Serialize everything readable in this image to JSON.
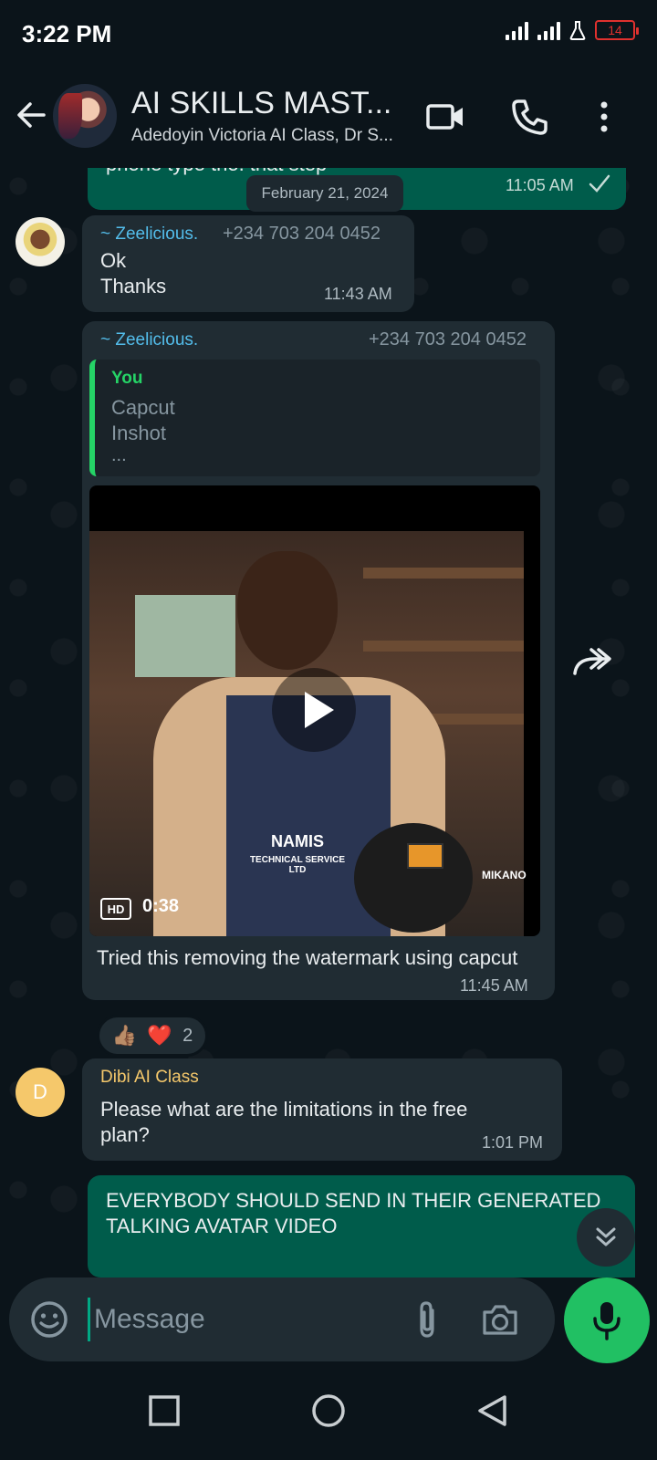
{
  "status_bar": {
    "time": "3:22 PM",
    "battery_level": "14",
    "icons": [
      "signal-icon",
      "signal-icon",
      "flask-icon",
      "battery-icon"
    ]
  },
  "header": {
    "title": "AI SKILLS MAST...",
    "subtitle": "Adedoyin Victoria AI Class, Dr S...",
    "icons": [
      "back-arrow-icon",
      "video-call-icon",
      "phone-icon",
      "more-vert-icon"
    ]
  },
  "chat": {
    "top_partial": {
      "text": "phone type tho.  that step",
      "time": "11:05 AM"
    },
    "date_chip": "February 21, 2024",
    "messages": [
      {
        "sender": "~ Zeelicious.",
        "phone": "+234 703 204 0452",
        "lines": [
          "Ok",
          "Thanks"
        ],
        "time": "11:43 AM"
      },
      {
        "sender": "~ Zeelicious.",
        "phone": "+234 703 204 0452",
        "quote": {
          "author": "You",
          "lines": [
            "Capcut",
            "Inshot",
            "..."
          ]
        },
        "video": {
          "badge": "HD",
          "duration": "0:38",
          "shirt_label": "NAMIS",
          "shirt_sublabel": "TECHNICAL SERVICE LTD",
          "side_text": "MIKANO"
        },
        "caption": "Tried this removing the watermark using capcut",
        "time": "11:45 AM",
        "reactions": {
          "emojis": [
            "👍🏽",
            "❤️"
          ],
          "count": "2"
        }
      },
      {
        "sender": "Dibi AI Class",
        "avatar_letter": "D",
        "lines": [
          "Please what are the limitations in the free",
          "plan?"
        ],
        "time": "1:01 PM"
      },
      {
        "outgoing": true,
        "lines": [
          "EVERYBODY SHOULD SEND IN THEIR GENERATED",
          "TALKING AVATAR VIDEO"
        ]
      }
    ]
  },
  "composer": {
    "placeholder": "Message",
    "icons": [
      "emoji-icon",
      "attach-icon",
      "camera-icon",
      "mic-icon"
    ]
  },
  "navbar": {
    "icons": [
      "recents-square-icon",
      "home-circle-icon",
      "back-triangle-icon"
    ]
  },
  "colors": {
    "background": "#0b141a",
    "incoming_bubble": "#202c33",
    "outgoing_bubble": "#005c4b",
    "accent_green": "#21c063",
    "sender_teal": "#53bdeb",
    "sender_gold": "#f5c86b"
  }
}
